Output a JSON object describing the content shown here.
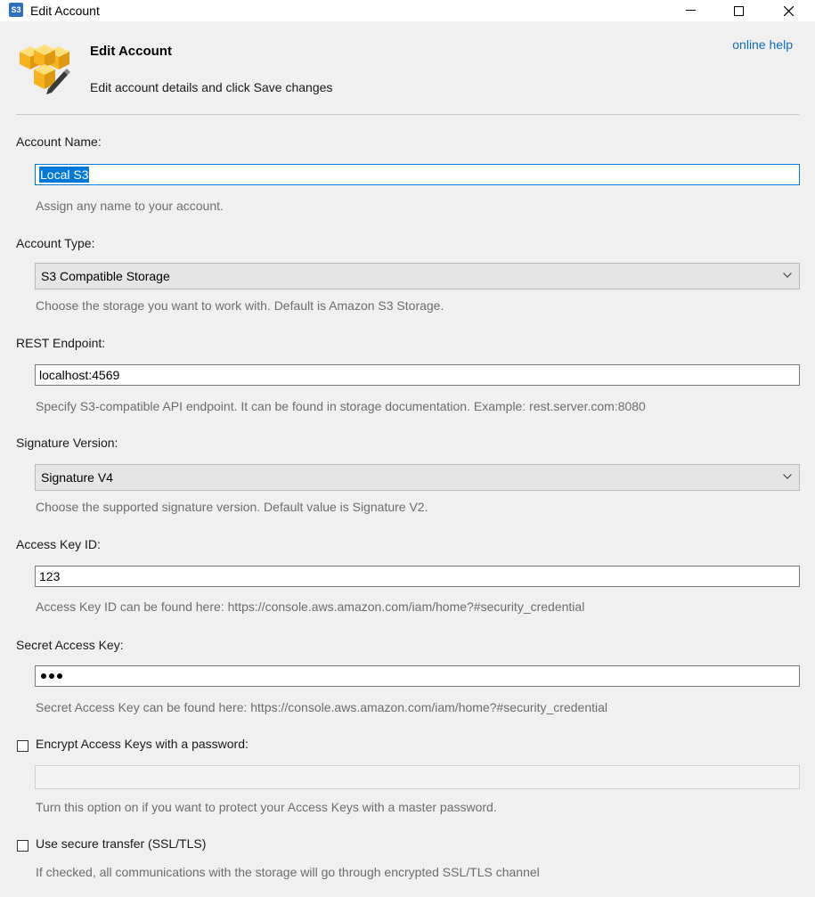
{
  "window": {
    "title": "Edit Account",
    "app_icon_text": "S3",
    "controls": [
      "minimize-icon",
      "maximize-icon",
      "close-icon"
    ]
  },
  "header": {
    "icon": "boxes-pencil-icon",
    "title": "Edit Account",
    "subtitle": "Edit account details and click Save changes",
    "help_link": "online help"
  },
  "account_name": {
    "label": "Account Name:",
    "value": "Local S3",
    "hint": "Assign any name to your account."
  },
  "account_type": {
    "label": "Account Type:",
    "value": "S3 Compatible Storage",
    "hint": "Choose the storage you want to work with. Default is Amazon S3 Storage."
  },
  "rest_endpoint": {
    "label": "REST Endpoint:",
    "value": "localhost:4569",
    "hint": "Specify S3-compatible API endpoint. It can be found in storage documentation. Example: rest.server.com:8080"
  },
  "signature_version": {
    "label": "Signature Version:",
    "value": "Signature V4",
    "hint": "Choose the supported signature version. Default value is Signature V2."
  },
  "access_key": {
    "label": "Access Key ID:",
    "value": "123",
    "hint": "Access Key ID can be found here: https://console.aws.amazon.com/iam/home?#security_credential"
  },
  "secret_key": {
    "label": "Secret Access Key:",
    "masked_length": 3,
    "hint": "Secret Access Key can be found here: https://console.aws.amazon.com/iam/home?#security_credential"
  },
  "encrypt": {
    "label": "Encrypt Access Keys with a password:",
    "checked": false,
    "password_value": "",
    "hint": "Turn this option on if you want to protect your Access Keys with a master password."
  },
  "ssl": {
    "label": "Use secure transfer (SSL/TLS)",
    "checked": false,
    "hint": "If checked, all communications with the storage will go through encrypted SSL/TLS channel"
  },
  "colors": {
    "accent": "#0078d7",
    "link": "#0f6cbd",
    "hint_text": "#6d6d6d",
    "icon_box": "#f5b320"
  }
}
